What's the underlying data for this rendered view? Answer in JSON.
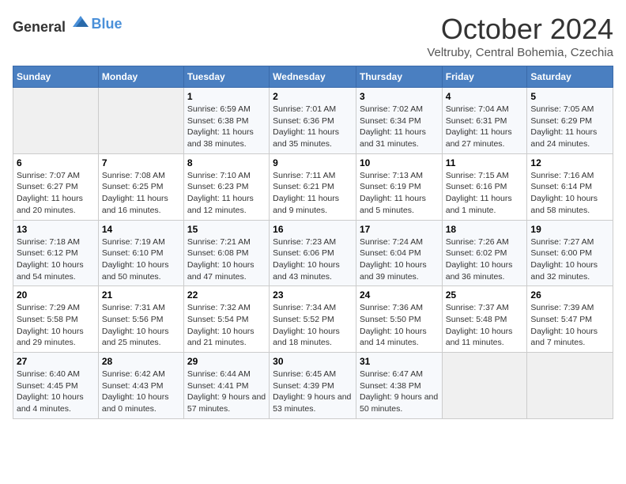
{
  "header": {
    "logo_general": "General",
    "logo_blue": "Blue",
    "month": "October 2024",
    "location": "Veltruby, Central Bohemia, Czechia"
  },
  "days_of_week": [
    "Sunday",
    "Monday",
    "Tuesday",
    "Wednesday",
    "Thursday",
    "Friday",
    "Saturday"
  ],
  "weeks": [
    [
      {
        "day": "",
        "sunrise": "",
        "sunset": "",
        "daylight": "",
        "empty": true
      },
      {
        "day": "",
        "sunrise": "",
        "sunset": "",
        "daylight": "",
        "empty": true
      },
      {
        "day": "1",
        "sunrise": "Sunrise: 6:59 AM",
        "sunset": "Sunset: 6:38 PM",
        "daylight": "Daylight: 11 hours and 38 minutes.",
        "empty": false
      },
      {
        "day": "2",
        "sunrise": "Sunrise: 7:01 AM",
        "sunset": "Sunset: 6:36 PM",
        "daylight": "Daylight: 11 hours and 35 minutes.",
        "empty": false
      },
      {
        "day": "3",
        "sunrise": "Sunrise: 7:02 AM",
        "sunset": "Sunset: 6:34 PM",
        "daylight": "Daylight: 11 hours and 31 minutes.",
        "empty": false
      },
      {
        "day": "4",
        "sunrise": "Sunrise: 7:04 AM",
        "sunset": "Sunset: 6:31 PM",
        "daylight": "Daylight: 11 hours and 27 minutes.",
        "empty": false
      },
      {
        "day": "5",
        "sunrise": "Sunrise: 7:05 AM",
        "sunset": "Sunset: 6:29 PM",
        "daylight": "Daylight: 11 hours and 24 minutes.",
        "empty": false
      }
    ],
    [
      {
        "day": "6",
        "sunrise": "Sunrise: 7:07 AM",
        "sunset": "Sunset: 6:27 PM",
        "daylight": "Daylight: 11 hours and 20 minutes.",
        "empty": false
      },
      {
        "day": "7",
        "sunrise": "Sunrise: 7:08 AM",
        "sunset": "Sunset: 6:25 PM",
        "daylight": "Daylight: 11 hours and 16 minutes.",
        "empty": false
      },
      {
        "day": "8",
        "sunrise": "Sunrise: 7:10 AM",
        "sunset": "Sunset: 6:23 PM",
        "daylight": "Daylight: 11 hours and 12 minutes.",
        "empty": false
      },
      {
        "day": "9",
        "sunrise": "Sunrise: 7:11 AM",
        "sunset": "Sunset: 6:21 PM",
        "daylight": "Daylight: 11 hours and 9 minutes.",
        "empty": false
      },
      {
        "day": "10",
        "sunrise": "Sunrise: 7:13 AM",
        "sunset": "Sunset: 6:19 PM",
        "daylight": "Daylight: 11 hours and 5 minutes.",
        "empty": false
      },
      {
        "day": "11",
        "sunrise": "Sunrise: 7:15 AM",
        "sunset": "Sunset: 6:16 PM",
        "daylight": "Daylight: 11 hours and 1 minute.",
        "empty": false
      },
      {
        "day": "12",
        "sunrise": "Sunrise: 7:16 AM",
        "sunset": "Sunset: 6:14 PM",
        "daylight": "Daylight: 10 hours and 58 minutes.",
        "empty": false
      }
    ],
    [
      {
        "day": "13",
        "sunrise": "Sunrise: 7:18 AM",
        "sunset": "Sunset: 6:12 PM",
        "daylight": "Daylight: 10 hours and 54 minutes.",
        "empty": false
      },
      {
        "day": "14",
        "sunrise": "Sunrise: 7:19 AM",
        "sunset": "Sunset: 6:10 PM",
        "daylight": "Daylight: 10 hours and 50 minutes.",
        "empty": false
      },
      {
        "day": "15",
        "sunrise": "Sunrise: 7:21 AM",
        "sunset": "Sunset: 6:08 PM",
        "daylight": "Daylight: 10 hours and 47 minutes.",
        "empty": false
      },
      {
        "day": "16",
        "sunrise": "Sunrise: 7:23 AM",
        "sunset": "Sunset: 6:06 PM",
        "daylight": "Daylight: 10 hours and 43 minutes.",
        "empty": false
      },
      {
        "day": "17",
        "sunrise": "Sunrise: 7:24 AM",
        "sunset": "Sunset: 6:04 PM",
        "daylight": "Daylight: 10 hours and 39 minutes.",
        "empty": false
      },
      {
        "day": "18",
        "sunrise": "Sunrise: 7:26 AM",
        "sunset": "Sunset: 6:02 PM",
        "daylight": "Daylight: 10 hours and 36 minutes.",
        "empty": false
      },
      {
        "day": "19",
        "sunrise": "Sunrise: 7:27 AM",
        "sunset": "Sunset: 6:00 PM",
        "daylight": "Daylight: 10 hours and 32 minutes.",
        "empty": false
      }
    ],
    [
      {
        "day": "20",
        "sunrise": "Sunrise: 7:29 AM",
        "sunset": "Sunset: 5:58 PM",
        "daylight": "Daylight: 10 hours and 29 minutes.",
        "empty": false
      },
      {
        "day": "21",
        "sunrise": "Sunrise: 7:31 AM",
        "sunset": "Sunset: 5:56 PM",
        "daylight": "Daylight: 10 hours and 25 minutes.",
        "empty": false
      },
      {
        "day": "22",
        "sunrise": "Sunrise: 7:32 AM",
        "sunset": "Sunset: 5:54 PM",
        "daylight": "Daylight: 10 hours and 21 minutes.",
        "empty": false
      },
      {
        "day": "23",
        "sunrise": "Sunrise: 7:34 AM",
        "sunset": "Sunset: 5:52 PM",
        "daylight": "Daylight: 10 hours and 18 minutes.",
        "empty": false
      },
      {
        "day": "24",
        "sunrise": "Sunrise: 7:36 AM",
        "sunset": "Sunset: 5:50 PM",
        "daylight": "Daylight: 10 hours and 14 minutes.",
        "empty": false
      },
      {
        "day": "25",
        "sunrise": "Sunrise: 7:37 AM",
        "sunset": "Sunset: 5:48 PM",
        "daylight": "Daylight: 10 hours and 11 minutes.",
        "empty": false
      },
      {
        "day": "26",
        "sunrise": "Sunrise: 7:39 AM",
        "sunset": "Sunset: 5:47 PM",
        "daylight": "Daylight: 10 hours and 7 minutes.",
        "empty": false
      }
    ],
    [
      {
        "day": "27",
        "sunrise": "Sunrise: 6:40 AM",
        "sunset": "Sunset: 4:45 PM",
        "daylight": "Daylight: 10 hours and 4 minutes.",
        "empty": false
      },
      {
        "day": "28",
        "sunrise": "Sunrise: 6:42 AM",
        "sunset": "Sunset: 4:43 PM",
        "daylight": "Daylight: 10 hours and 0 minutes.",
        "empty": false
      },
      {
        "day": "29",
        "sunrise": "Sunrise: 6:44 AM",
        "sunset": "Sunset: 4:41 PM",
        "daylight": "Daylight: 9 hours and 57 minutes.",
        "empty": false
      },
      {
        "day": "30",
        "sunrise": "Sunrise: 6:45 AM",
        "sunset": "Sunset: 4:39 PM",
        "daylight": "Daylight: 9 hours and 53 minutes.",
        "empty": false
      },
      {
        "day": "31",
        "sunrise": "Sunrise: 6:47 AM",
        "sunset": "Sunset: 4:38 PM",
        "daylight": "Daylight: 9 hours and 50 minutes.",
        "empty": false
      },
      {
        "day": "",
        "sunrise": "",
        "sunset": "",
        "daylight": "",
        "empty": true
      },
      {
        "day": "",
        "sunrise": "",
        "sunset": "",
        "daylight": "",
        "empty": true
      }
    ]
  ]
}
